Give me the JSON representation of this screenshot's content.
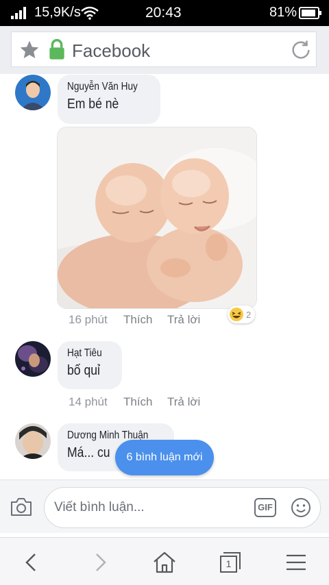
{
  "status_bar": {
    "network_speed": "15,9K/s",
    "time": "20:43",
    "battery": "81%"
  },
  "address_bar": {
    "title": "Facebook",
    "icons": [
      "star-icon",
      "lock-icon",
      "reload-icon"
    ]
  },
  "comments": [
    {
      "author": "Nguyễn Văn Huy",
      "text": "Em bé nè",
      "has_photo": true,
      "time": "16 phút",
      "like_label": "Thích",
      "reply_label": "Trả lời",
      "reaction": {
        "icon": "laugh-emoji-icon",
        "count": "2"
      }
    },
    {
      "author": "Hạt Tiêu",
      "text": "bố quỉ",
      "time": "14 phút",
      "like_label": "Thích",
      "reply_label": "Trả lời"
    },
    {
      "author": "Dương Minh Thuận",
      "text": "Má... cu"
    }
  ],
  "new_comments_pill": "6 bình luận mới",
  "composer": {
    "placeholder": "Viết bình luận...",
    "gif_label": "GIF",
    "icons": [
      "camera-icon",
      "gif-icon",
      "emoji-icon"
    ]
  },
  "bottom_nav": {
    "tab_count": "1",
    "icons": [
      "back-icon",
      "forward-icon",
      "home-icon",
      "tabs-icon",
      "menu-icon"
    ]
  }
}
